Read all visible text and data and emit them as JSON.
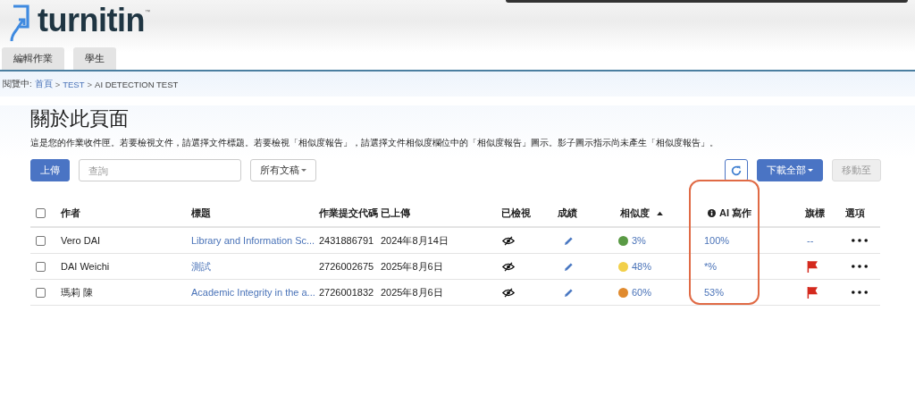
{
  "logo": {
    "name": "turnitin",
    "trademark": "™"
  },
  "tabs": [
    {
      "label": "編輯作業",
      "selected": false
    },
    {
      "label": "學生",
      "selected": false
    }
  ],
  "breadcrumb": {
    "prefix": "閱覽中:",
    "items": [
      {
        "label": "首頁",
        "link": true
      },
      {
        "label": "TEST",
        "link": true
      },
      {
        "label": "AI DETECTION TEST",
        "link": false
      }
    ],
    "separator": ">"
  },
  "page": {
    "title": "關於此頁面",
    "description": "這是您的作業收件匣。若要檢視文件，請選擇文件標題。若要檢視「相似度報告」，請選擇文件相似度欄位中的「相似度報告」圖示。影子圖示指示尚未產生「相似度報告」。"
  },
  "toolbar": {
    "upload": "上傳",
    "search": {
      "placeholder": "查詢"
    },
    "filter": "所有文稿",
    "download": "下載全部",
    "move": {
      "label": "移動至",
      "disabled": true
    }
  },
  "table": {
    "select_all": {
      "checked": false
    },
    "columns": [
      {
        "label": "作者"
      },
      {
        "label": "標題"
      },
      {
        "label": "作業提交代碼"
      },
      {
        "label": "已上傳"
      },
      {
        "label": "已檢視"
      },
      {
        "label": "成績"
      },
      {
        "label": "相似度",
        "sorted": true
      },
      {
        "label": "AI 寫作",
        "info": true,
        "circled": true
      },
      {
        "label": "旗標"
      },
      {
        "label": "選項"
      }
    ],
    "rows": [
      {
        "checked": false,
        "author": "Vero DAI",
        "title": "Library and Information Sc...",
        "code": "2431886791",
        "uploaded": "2024年8月14日",
        "viewed": false,
        "similarity": "3%",
        "color": "#5a9a45",
        "ai": "100%",
        "flagged": false,
        "flag_placeholder": "--"
      },
      {
        "checked": false,
        "author": "DAI Weichi",
        "title": "測試",
        "code": "2726002675",
        "uploaded": "2025年8月6日",
        "viewed": false,
        "similarity": "48%",
        "color": "#f2d04a",
        "ai": "*%",
        "flagged": true
      },
      {
        "checked": false,
        "author": "瑪莉 陳",
        "title": "Academic Integrity in the a...",
        "code": "2726001832",
        "uploaded": "2025年8月6日",
        "viewed": false,
        "similarity": "60%",
        "color": "#e08a2e",
        "ai": "53%",
        "flagged": true
      }
    ]
  }
}
